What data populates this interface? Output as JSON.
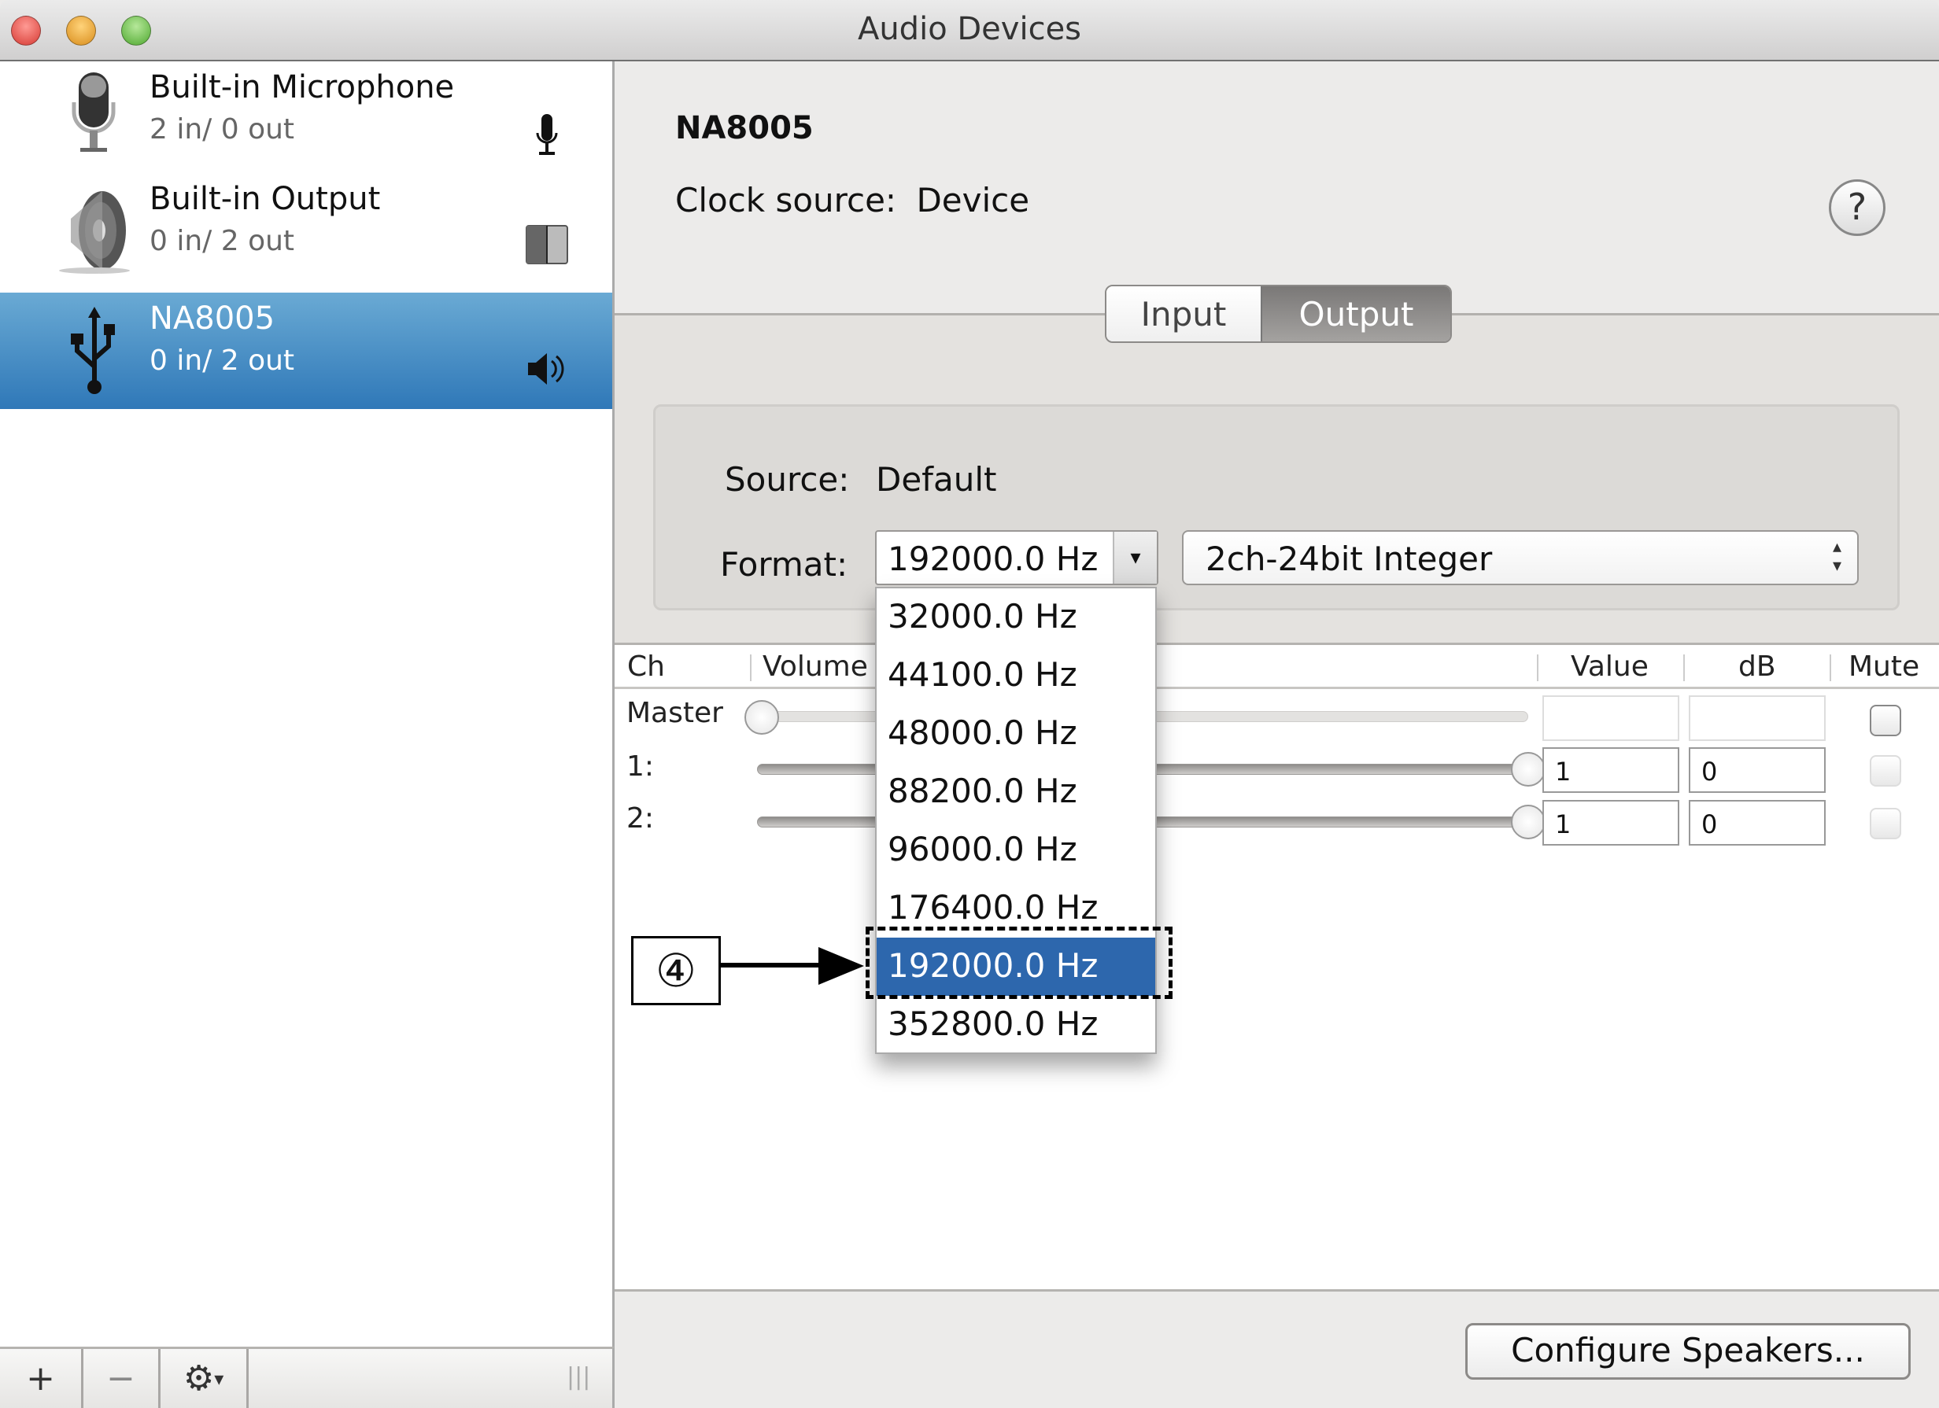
{
  "window": {
    "title": "Audio Devices",
    "traffic_lights": {
      "close_color": "#e0443e",
      "minimize_color": "#dea123",
      "zoom_color": "#5fba3b"
    }
  },
  "sidebar": {
    "devices": [
      {
        "name": "Built-in Microphone",
        "io": "2 in/ 0 out",
        "icon": "microphone-icon",
        "status_icon": "microphone-small-icon",
        "selected": false
      },
      {
        "name": "Built-in Output",
        "io": "0 in/ 2 out",
        "icon": "speaker-icon",
        "status_icon": "finder-icon",
        "selected": false
      },
      {
        "name": "NA8005",
        "io": "0 in/ 2 out",
        "icon": "usb-icon",
        "status_icon": "speaker-volume-icon",
        "selected": true
      }
    ],
    "toolbar": {
      "add_label": "+",
      "remove_label": "−",
      "gear_label": "⚙",
      "gear_caret": "▾",
      "resize_label": "|||"
    }
  },
  "main": {
    "device_name": "NA8005",
    "clock_source_label": "Clock source:",
    "clock_source_value": "Device",
    "help_label": "?",
    "tabs": [
      {
        "label": "Input",
        "active": false
      },
      {
        "label": "Output",
        "active": true
      }
    ],
    "source_label": "Source:",
    "source_value": "Default",
    "format_label": "Format:",
    "sample_rate_value": "192000.0 Hz",
    "sample_rate_arrow": "▾",
    "bit_format_value": "2ch-24bit Integer",
    "bit_format_arrows": "▴\n▾",
    "sample_rate_options": [
      "32000.0 Hz",
      "44100.0 Hz",
      "48000.0 Hz",
      "88200.0 Hz",
      "96000.0 Hz",
      "176400.0 Hz",
      "192000.0 Hz",
      "352800.0 Hz"
    ],
    "selected_option_index": 6,
    "table": {
      "headers": {
        "ch": "Ch",
        "volume": "Volume",
        "value": "Value",
        "db": "dB",
        "mute": "Mute"
      },
      "rows": [
        {
          "ch": "Master",
          "volume": 0,
          "value": "",
          "db": "",
          "mute": false,
          "enabled": false
        },
        {
          "ch": "1:",
          "volume": 1,
          "value": "1",
          "db": "0",
          "mute": false,
          "enabled": true
        },
        {
          "ch": "2:",
          "volume": 1,
          "value": "1",
          "db": "0",
          "mute": false,
          "enabled": true
        }
      ]
    },
    "configure_label": "Configure Speakers..."
  },
  "annotation": {
    "step_label": "④",
    "accent": "#2d67ad"
  }
}
